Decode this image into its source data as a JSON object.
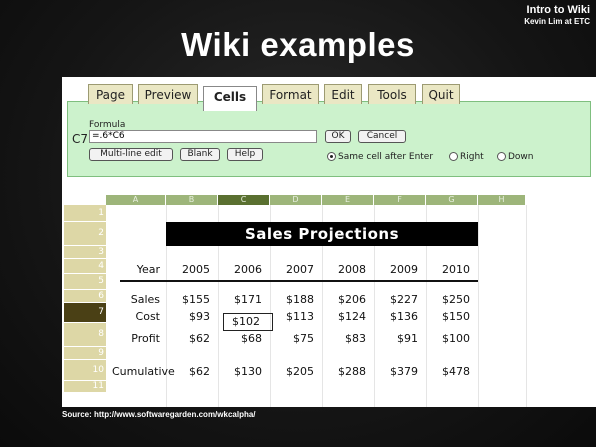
{
  "slide": {
    "title": "Wiki examples",
    "corner_line1": "Intro to Wiki",
    "corner_line2": "Kevin Lim at ETC",
    "source": "Source: http://www.softwaregarden.com/wkcalpha/"
  },
  "tabs": [
    "Page",
    "Preview",
    "Cells",
    "Format",
    "Edit",
    "Tools",
    "Quit"
  ],
  "active_tab": "Cells",
  "formula_panel": {
    "label": "Formula",
    "cell_ref": "C7",
    "value": "=.6*C6",
    "ok": "OK",
    "cancel": "Cancel",
    "multiline": "Multi-line edit",
    "blank": "Blank",
    "help": "Help",
    "radio_same": "Same cell after Enter",
    "radio_right": "Right",
    "radio_down": "Down",
    "selected_radio": "Same cell after Enter"
  },
  "sheet": {
    "columns": [
      "A",
      "B",
      "C",
      "D",
      "E",
      "F",
      "G",
      "H"
    ],
    "selected_column": "C",
    "rows": [
      "1",
      "2",
      "3",
      "4",
      "5",
      "6",
      "7",
      "8",
      "9",
      "10",
      "11"
    ],
    "selected_row": "7",
    "banner": "Sales Projections",
    "year_label": "Year",
    "years": [
      "2005",
      "2006",
      "2007",
      "2008",
      "2009",
      "2010"
    ],
    "sales_label": "Sales",
    "sales": [
      "$155",
      "$171",
      "$188",
      "$206",
      "$227",
      "$250"
    ],
    "cost_label": "Cost",
    "cost": [
      "$93",
      "$102",
      "$113",
      "$124",
      "$136",
      "$150"
    ],
    "profit_label": "Profit",
    "profit": [
      "$62",
      "$68",
      "$75",
      "$83",
      "$91",
      "$100"
    ],
    "cumulative_label": "Cumulative",
    "cumulative": [
      "$62",
      "$130",
      "$205",
      "$288",
      "$379",
      "$478"
    ]
  }
}
